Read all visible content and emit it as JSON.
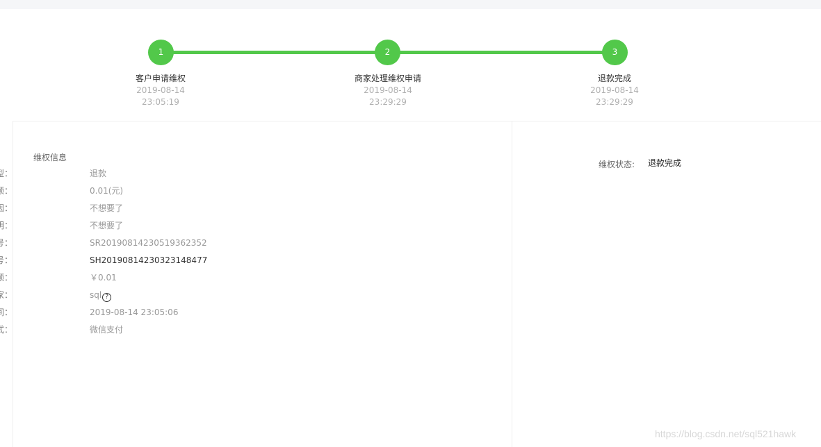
{
  "steps": [
    {
      "number": "1",
      "title": "客户申请维权",
      "date": "2019-08-14",
      "time": "23:05:19"
    },
    {
      "number": "2",
      "title": "商家处理维权申请",
      "date": "2019-08-14",
      "time": "23:29:29"
    },
    {
      "number": "3",
      "title": "退款完成",
      "date": "2019-08-14",
      "time": "23:29:29"
    }
  ],
  "info": {
    "heading": "维权信息",
    "rows": [
      {
        "label": "维权类型：",
        "value": "退款"
      },
      {
        "label": "退款金额：",
        "value": "0.01(元)"
      },
      {
        "label": "维权原因：",
        "value": "不想要了"
      },
      {
        "label": "维权说明：",
        "value": "不想要了"
      },
      {
        "label": "维权编号：",
        "value": "SR20190814230519362352"
      },
      {
        "label": "订单编号：",
        "value": "SH20190814230323148477"
      },
      {
        "label": "订单金额：",
        "value": "￥0.01"
      },
      {
        "label": "买家：",
        "value": "sql"
      },
      {
        "label": "付款时间：",
        "value": "2019-08-14 23:05:06"
      },
      {
        "label": "付款方式：",
        "value": "微信支付"
      }
    ]
  },
  "status": {
    "label": "维权状态:",
    "value": "退款完成"
  },
  "watermark": "https://blog.csdn.net/sql521hawk",
  "colors": {
    "accent": "#52c84a"
  }
}
